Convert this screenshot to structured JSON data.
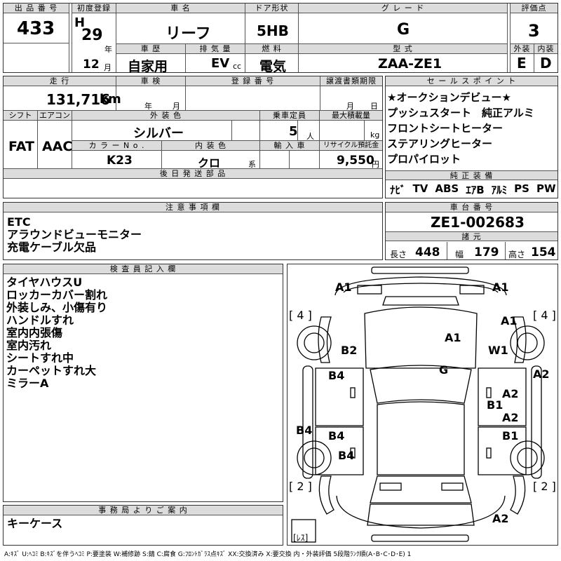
{
  "lot": {
    "label": "出 品 番 号",
    "value": "433"
  },
  "first_reg": {
    "label": "初度登録",
    "era": "H",
    "year": "29",
    "year_unit": "年",
    "month": "12",
    "month_unit": "月"
  },
  "car_name": {
    "label": "車 名",
    "value": "リーフ"
  },
  "door": {
    "label": "ドア形状",
    "value": "5HB"
  },
  "grade": {
    "label": "グ レ ー ド",
    "value": "G"
  },
  "score": {
    "label": "評価点",
    "value": "3"
  },
  "history": {
    "label": "車 歴",
    "value": "自家用"
  },
  "displacement": {
    "label": "排 気 量",
    "value": "EV",
    "unit": "cc"
  },
  "fuel": {
    "label": "燃 料",
    "value": "電気"
  },
  "model": {
    "label": "型 式",
    "value": "ZAA-ZE1"
  },
  "exterior_grade": {
    "label": "外装",
    "value": "E"
  },
  "interior_grade": {
    "label": "内装",
    "value": "D"
  },
  "mileage": {
    "label": "走 行",
    "value": "131,716",
    "unit": "km"
  },
  "inspection": {
    "label": "車 検",
    "year_unit": "年",
    "month_unit": "月"
  },
  "registration": {
    "label": "登 録 番 号"
  },
  "transfer_deadline": {
    "label": "譲渡書類期限",
    "month_unit": "月",
    "day_unit": "日"
  },
  "shift": {
    "label": "シフト",
    "value": "FAT"
  },
  "aircon": {
    "label": "エアコン",
    "value": "AAC"
  },
  "exterior_color": {
    "label": "外 装 色",
    "value": "シルバー"
  },
  "capacity": {
    "label": "乗車定員",
    "value": "5",
    "unit": "人"
  },
  "max_load": {
    "label": "最大積載量",
    "unit": "kg"
  },
  "color_no": {
    "label": "カ ラ ー N o .",
    "value": "K23"
  },
  "interior_color": {
    "label": "内 装 色",
    "value": "クロ",
    "unit": "系"
  },
  "import": {
    "label": "輸 入 車"
  },
  "recycle": {
    "label": "リサイクル預託金",
    "value": "9,550",
    "unit": "円"
  },
  "later_parts": {
    "label": "後 日 発 送 部 品"
  },
  "sales_points": {
    "label": "セ ー ル ス ポ イ ン ト",
    "items": [
      "★オークションデビュー★",
      "プッシュスタート　純正アルミ",
      "フロントシートヒーター",
      "ステアリングヒーター",
      "プロパイロット"
    ]
  },
  "equipment": {
    "label": "純 正 装 備",
    "items": [
      "ﾅﾋﾞ",
      "TV",
      "ABS",
      "ｴｱB",
      "ｱﾙﾐ",
      "PS",
      "PW"
    ]
  },
  "notes": {
    "label": "注 意 事 項 欄",
    "lines": [
      "ETC",
      "アラウンドビューモニター",
      "充電ケーブル欠品"
    ]
  },
  "chassis": {
    "label": "車 台 番 号",
    "value": "ZE1-002683"
  },
  "specs": {
    "label": "諸 元",
    "length_label": "長さ",
    "length": "448",
    "width_label": "幅",
    "width": "179",
    "height_label": "高さ",
    "height": "154"
  },
  "inspector": {
    "label": "検 査 員 記 入 欄",
    "lines": [
      "タイヤハウスU",
      "ロッカーカバー割れ",
      "外装しみ、小傷有り",
      "ハンドルすれ",
      "室内内張傷",
      "室内汚れ",
      "シートすれ中",
      "カーペットすれ大",
      "ミラーA"
    ]
  },
  "office": {
    "label": "事 務 局 よ り ご 案 内",
    "lines": [
      "キーケース"
    ]
  },
  "diagram": {
    "marks": [
      {
        "id": "front-left-a1",
        "text": "A1"
      },
      {
        "id": "front-right-a1",
        "text": "A1"
      },
      {
        "id": "tire-fl",
        "text": "[ 4 ]"
      },
      {
        "id": "tire-fr",
        "text": "[ 4 ]"
      },
      {
        "id": "fender-r-a1",
        "text": "A1"
      },
      {
        "id": "hood-a1",
        "text": "A1"
      },
      {
        "id": "fender-l-b2",
        "text": "B2"
      },
      {
        "id": "windshield-w1",
        "text": "W1"
      },
      {
        "id": "roof-g",
        "text": "G"
      },
      {
        "id": "right-side-a2",
        "text": "A2"
      },
      {
        "id": "left-door-b4-front",
        "text": "B4"
      },
      {
        "id": "right-door-a2-front",
        "text": "A2"
      },
      {
        "id": "right-b1-mid",
        "text": "B1"
      },
      {
        "id": "right-door-a2-rear",
        "text": "A2"
      },
      {
        "id": "left-rocker-b4",
        "text": "B4"
      },
      {
        "id": "left-door-b4-rear",
        "text": "B4"
      },
      {
        "id": "right-door-b1-rear",
        "text": "B1"
      },
      {
        "id": "left-quarter-b4",
        "text": "B4"
      },
      {
        "id": "tire-rl",
        "text": "[ 2 ]"
      },
      {
        "id": "tire-rr",
        "text": "[ 2 ]"
      },
      {
        "id": "rear-bumper-a2",
        "text": "A2"
      },
      {
        "id": "spare",
        "text": "[ﾚｽ]"
      }
    ]
  },
  "legend": "A:ｷｽﾞ U:ﾍｺﾐ B:ｷｽﾞを伴うﾍｺﾐ P:要塗装 W:補修跡 S:錆 C:腐食 G:ﾌﾛﾝﾄｶﾞﾗｽ点ｷｽﾞ XX:交換済み X:要交換 内・外装評価 5段階ﾗﾝｸ順(A･B･C･D･E) 1"
}
